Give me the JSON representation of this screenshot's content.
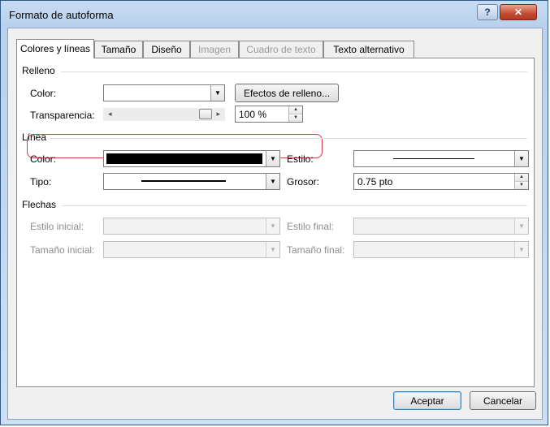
{
  "window": {
    "title": "Formato de autoforma",
    "help_label": "?",
    "close_label": "✕"
  },
  "tabs": [
    {
      "label": "Colores y líneas",
      "state": "active"
    },
    {
      "label": "Tamaño",
      "state": "normal"
    },
    {
      "label": "Diseño",
      "state": "normal"
    },
    {
      "label": "Imagen",
      "state": "disabled"
    },
    {
      "label": "Cuadro de texto",
      "state": "disabled"
    },
    {
      "label": "Texto alternativo",
      "state": "normal"
    }
  ],
  "relleno": {
    "title": "Relleno",
    "color_label": "Color:",
    "effects_button": "Efectos de relleno...",
    "transparency_label": "Transparencia:",
    "transparency_value": "100 %",
    "transparency_percent": 100
  },
  "linea": {
    "title": "Línea",
    "color_label": "Color:",
    "color_value": "#000000",
    "tipo_label": "Tipo:",
    "estilo_label": "Estilo:",
    "grosor_label": "Grosor:",
    "grosor_value": "0.75 pto"
  },
  "flechas": {
    "title": "Flechas",
    "estilo_inicial_label": "Estilo inicial:",
    "estilo_final_label": "Estilo final:",
    "tamano_inicial_label": "Tamaño inicial:",
    "tamano_final_label": "Tamaño final:"
  },
  "footer": {
    "accept_label": "Aceptar",
    "cancel_label": "Cancelar"
  },
  "colors": {
    "highlight": "#d8383f",
    "close_button": "#c54b31"
  },
  "icons": {
    "dropdown": "chevron-down-icon",
    "spin_up": "arrow-up-icon",
    "spin_down": "arrow-down-icon",
    "slider_left": "arrow-left-icon",
    "slider_right": "arrow-right-icon"
  }
}
